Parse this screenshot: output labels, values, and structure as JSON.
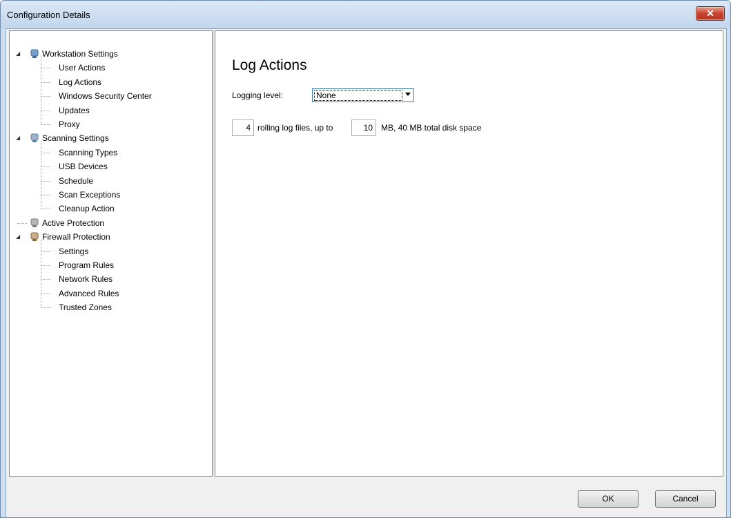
{
  "window": {
    "title": "Configuration Details",
    "close_glyph": "✕"
  },
  "tree": [
    {
      "label": "Workstation Settings",
      "level": 0,
      "expanded": true,
      "icon": "workstation-icon",
      "children": [
        {
          "label": "User Actions"
        },
        {
          "label": "Log Actions"
        },
        {
          "label": "Windows Security Center"
        },
        {
          "label": "Updates"
        },
        {
          "label": "Proxy"
        }
      ]
    },
    {
      "label": "Scanning Settings",
      "level": 0,
      "expanded": true,
      "icon": "scanning-icon",
      "children": [
        {
          "label": "Scanning Types"
        },
        {
          "label": "USB Devices"
        },
        {
          "label": "Schedule"
        },
        {
          "label": "Scan Exceptions"
        },
        {
          "label": "Cleanup Action"
        }
      ]
    },
    {
      "label": "Active Protection",
      "level": 0,
      "expanded": false,
      "icon": "active-protection-icon",
      "children": []
    },
    {
      "label": "Firewall Protection",
      "level": 0,
      "expanded": true,
      "icon": "firewall-icon",
      "children": [
        {
          "label": "Settings"
        },
        {
          "label": "Program Rules"
        },
        {
          "label": "Network Rules"
        },
        {
          "label": "Advanced Rules"
        },
        {
          "label": "Trusted Zones"
        }
      ]
    }
  ],
  "content": {
    "heading": "Log Actions",
    "logging_level_label": "Logging level:",
    "logging_level_value": "None",
    "rolling_count": "4",
    "rolling_text": "rolling log files, up to",
    "max_size": "10",
    "size_text": "MB, 40 MB total disk space"
  },
  "buttons": {
    "ok": "OK",
    "cancel": "Cancel"
  }
}
